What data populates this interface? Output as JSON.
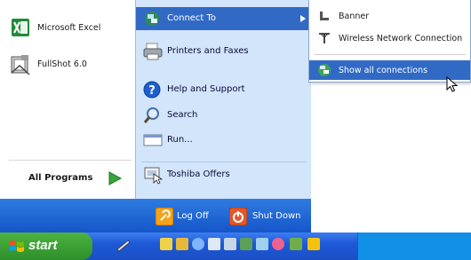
{
  "left": {
    "items": [
      {
        "label": "Microsoft Excel",
        "icon": "excel-icon"
      },
      {
        "label": "FullShot 6.0",
        "icon": "fullshot-icon"
      }
    ],
    "all_programs": "All Programs"
  },
  "right": {
    "items": [
      {
        "label": "Connect To",
        "icon": "network-connections-icon"
      },
      {
        "label": "Printers and Faxes",
        "icon": "printer-icon"
      },
      {
        "label": "Help and Support",
        "icon": "help-icon"
      },
      {
        "label": "Search",
        "icon": "search-icon"
      },
      {
        "label": "Run...",
        "icon": "run-icon"
      },
      {
        "label": "Toshiba Offers",
        "icon": "toshiba-icon"
      }
    ]
  },
  "submenu": {
    "items": [
      {
        "label": "Banner",
        "icon": "dialup-icon"
      },
      {
        "label": "Wireless Network Connection",
        "icon": "wireless-antenna-icon"
      },
      {
        "label": "Show all connections",
        "icon": "network-connections-icon"
      }
    ]
  },
  "footer": {
    "logoff": "Log Off",
    "shutdown": "Shut Down"
  },
  "taskbar": {
    "start": "start"
  },
  "colors": {
    "highlight": "#316ac5",
    "start_green": "#3aa335",
    "taskbar_blue": "#245edb",
    "right_pane": "#d3e5fa"
  }
}
